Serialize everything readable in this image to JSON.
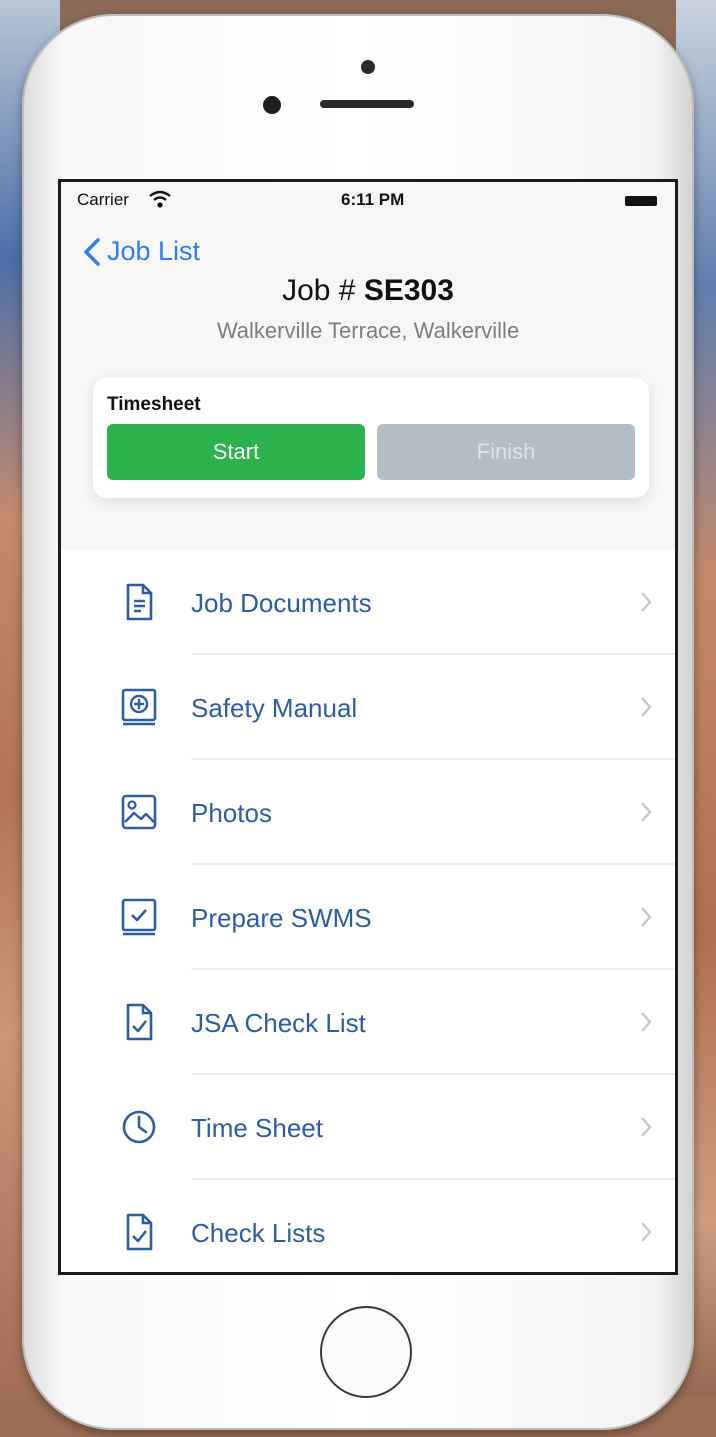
{
  "status_bar": {
    "carrier": "Carrier",
    "time": "6:11 PM"
  },
  "nav": {
    "back_label": "Job List"
  },
  "job": {
    "title_prefix": "Job # ",
    "number": "SE303",
    "address": "Walkerville Terrace, Walkerville"
  },
  "timesheet": {
    "label": "Timesheet",
    "start_label": "Start",
    "finish_label": "Finish",
    "start_color": "#2bb24c",
    "finish_color": "#b4bec7"
  },
  "menu": {
    "accent_color": "#2d5da6",
    "items": [
      {
        "label": "Job Documents",
        "icon": "document-icon"
      },
      {
        "label": "Safety Manual",
        "icon": "manual-icon"
      },
      {
        "label": "Photos",
        "icon": "photo-icon"
      },
      {
        "label": "Prepare SWMS",
        "icon": "checkbox-book-icon"
      },
      {
        "label": "JSA Check List",
        "icon": "checklist-icon"
      },
      {
        "label": "Time Sheet",
        "icon": "clock-icon"
      },
      {
        "label": "Check Lists",
        "icon": "checklist-icon"
      }
    ]
  }
}
